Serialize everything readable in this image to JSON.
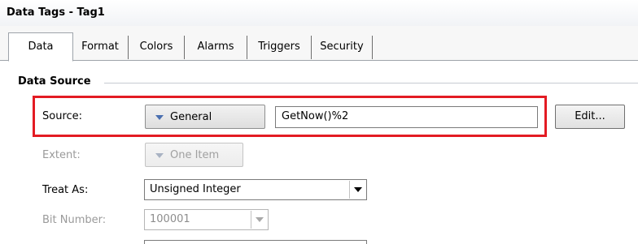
{
  "window": {
    "title": "Data Tags - Tag1"
  },
  "tabs": [
    {
      "label": "Data",
      "active": true
    },
    {
      "label": "Format",
      "active": false
    },
    {
      "label": "Colors",
      "active": false
    },
    {
      "label": "Alarms",
      "active": false
    },
    {
      "label": "Triggers",
      "active": false
    },
    {
      "label": "Security",
      "active": false
    }
  ],
  "section": {
    "title": "Data Source"
  },
  "source": {
    "label": "Source:",
    "type_button": "General",
    "value": "GetNow()%2",
    "edit_button": "Edit..."
  },
  "extent": {
    "label": "Extent:",
    "button": "One Item",
    "enabled": false
  },
  "treat_as": {
    "label": "Treat As:",
    "value": "Unsigned Integer"
  },
  "bit_number": {
    "label": "Bit Number:",
    "value": "100001",
    "enabled": false
  },
  "colors": {
    "highlight": "#e31b23",
    "accent_arrow": "#4a6fb0"
  }
}
